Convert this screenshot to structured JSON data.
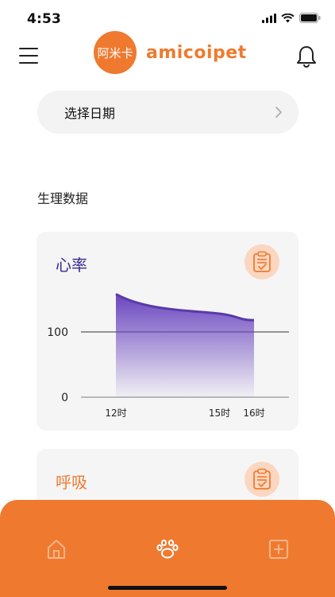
{
  "status_bar": {
    "time": "4:53",
    "icons": [
      "signal-icon",
      "wifi-icon",
      "battery-icon"
    ]
  },
  "header": {
    "logo_badge_text": "阿米卡",
    "logo_wordmark": "amicoipet",
    "menu_icon": "menu-icon",
    "notification_icon": "bell-icon"
  },
  "date_picker": {
    "label": "选择日期",
    "chevron": "chevron-right-icon"
  },
  "section": {
    "title": "生理数据"
  },
  "cards": [
    {
      "title": "心率",
      "icon": "clipboard-check-icon"
    },
    {
      "title": "呼吸",
      "icon": "clipboard-check-icon"
    }
  ],
  "chart_data": {
    "type": "area",
    "title": "心率",
    "categories": [
      "12时",
      "15时",
      "16时"
    ],
    "x": [
      12,
      15,
      16
    ],
    "values": [
      158,
      128,
      118
    ],
    "yticks": [
      0,
      100
    ],
    "ylim": [
      0,
      165
    ],
    "grid": true,
    "colors": {
      "line": "#5a3aa8",
      "fill_top": "#6a45c0"
    }
  },
  "tab_bar": {
    "tabs": [
      {
        "icon": "home-icon",
        "active": false
      },
      {
        "icon": "paw-icon",
        "active": true
      },
      {
        "icon": "add-box-icon",
        "active": false
      }
    ]
  },
  "colors": {
    "accent": "#ef7a2f",
    "purple": "#3a2a8f",
    "card_bg": "#f5f5f5"
  }
}
